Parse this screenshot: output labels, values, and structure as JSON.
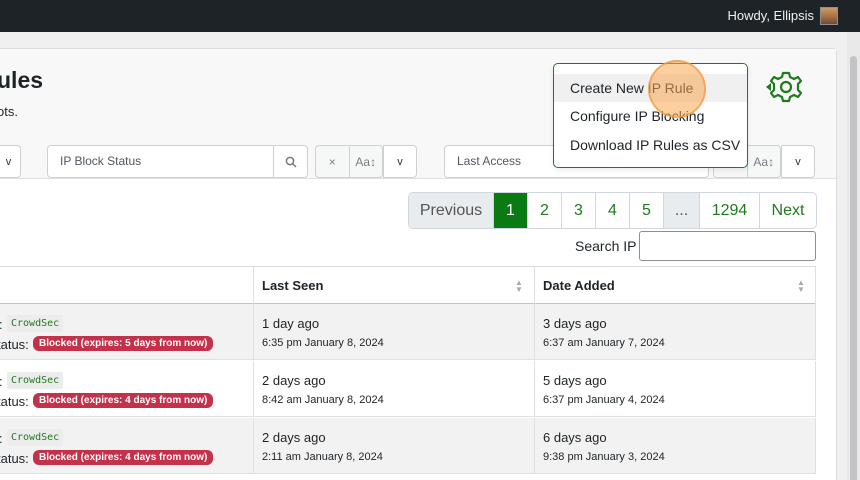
{
  "adminbar": {
    "greeting": "Howdy, Ellipsis"
  },
  "page": {
    "title": "ules",
    "subtitle": "ots."
  },
  "filters": {
    "ip_block_status_placeholder": "IP Block Status",
    "last_access_placeholder": "Last Access",
    "clear_glyph": "×",
    "case_glyph": "Aa↕",
    "chevron_glyph": "v"
  },
  "menu": {
    "items": [
      "Create New IP Rule",
      "Configure IP Blocking",
      "Download IP Rules as CSV"
    ]
  },
  "pagination": {
    "previous": "Previous",
    "pages": [
      "1",
      "2",
      "3",
      "4",
      "5"
    ],
    "ellipsis": "...",
    "last_page": "1294",
    "next": "Next",
    "active_page": "1"
  },
  "search": {
    "label": "Search IP"
  },
  "table": {
    "columns": [
      "Last Seen",
      "Date Added"
    ],
    "source_label": ":",
    "status_label": "tatus:",
    "rows": [
      {
        "source": "CrowdSec",
        "status": "Blocked (expires: 5 days from now)",
        "last_seen": "1 day ago",
        "last_seen_date": "6:35 pm January 8, 2024",
        "added": "3 days ago",
        "added_date": "6:37 am January 7, 2024"
      },
      {
        "source": "CrowdSec",
        "status": "Blocked (expires: 4 days from now)",
        "last_seen": "2 days ago",
        "last_seen_date": "8:42 am January 8, 2024",
        "added": "5 days ago",
        "added_date": "6:37 pm January 4, 2024"
      },
      {
        "source": "CrowdSec",
        "status": "Blocked (expires: 4 days from now)",
        "last_seen": "2 days ago",
        "last_seen_date": "2:11 am January 8, 2024",
        "added": "6 days ago",
        "added_date": "9:38 pm January 3, 2024"
      }
    ]
  },
  "colors": {
    "accent_green": "#1d7b1d",
    "active_page": "#0a7a12",
    "blocked_badge": "#c4314b",
    "admin_bar": "#1d2327"
  }
}
